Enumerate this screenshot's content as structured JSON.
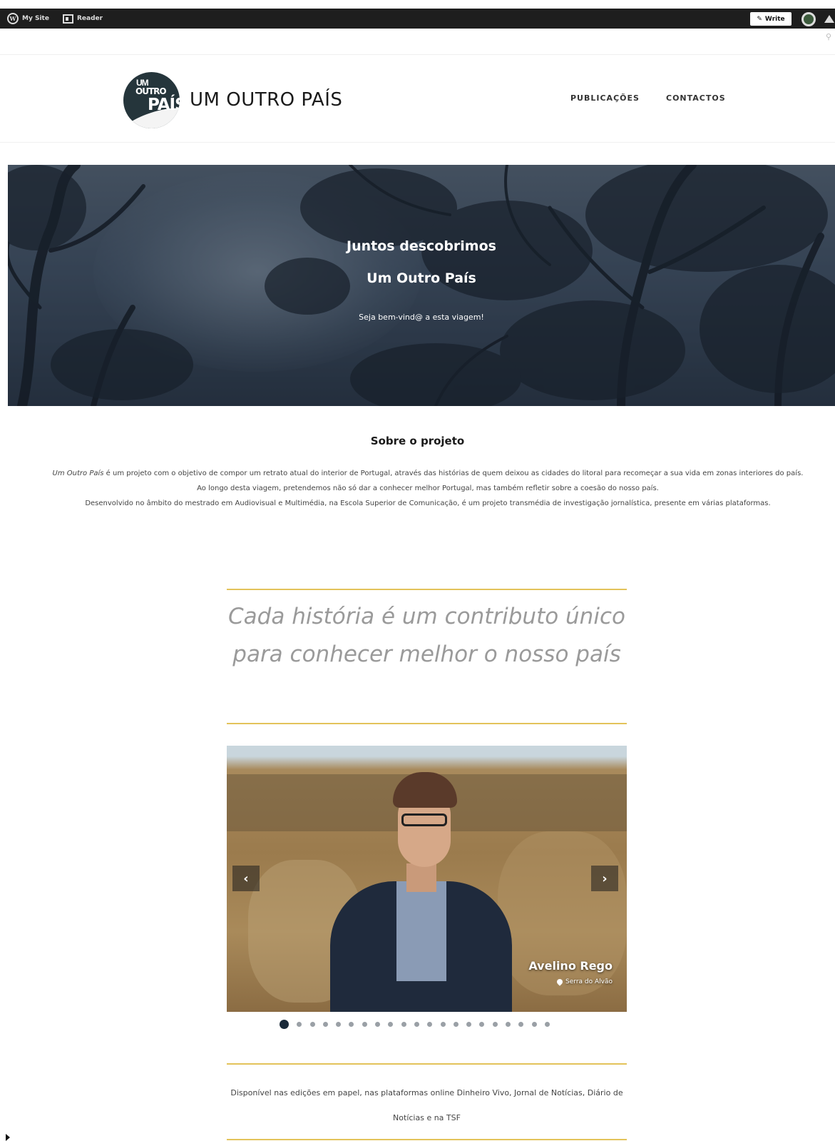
{
  "adminbar": {
    "my_site": "My Site",
    "reader": "Reader",
    "write": "Write"
  },
  "header": {
    "logo": {
      "line1": "UM",
      "line2": "OUTRO",
      "line3": "PAÍS"
    },
    "site_title": "UM OUTRO PAÍS",
    "nav": [
      "PUBLICAÇÕES",
      "CONTACTOS"
    ]
  },
  "hero": {
    "title_line1": "Juntos descobrimos",
    "title_line2": "Um Outro País",
    "subtitle": "Seja bem-vind@ a esta viagem!"
  },
  "about": {
    "title": "Sobre o projeto",
    "para1_em": "Um Outro País",
    "para1": " é um projeto com o objetivo de compor um retrato atual do interior de Portugal, através das histórias de quem deixou as cidades do litoral para recomeçar a sua vida em zonas interiores do país. Ao longo desta viagem, pretendemos não só dar a conhecer melhor Portugal, mas também refletir sobre a coesão do nosso país.",
    "para2": "Desenvolvido no âmbito do mestrado em Audiovisual e Multimédia, na Escola Superior de Comunicação, é um projeto transmédia de investigação jornalística, presente em várias plataformas."
  },
  "quote": "Cada história é um contributo único para conhecer melhor o nosso país",
  "carousel": {
    "caption_name": "Avelino Rego",
    "caption_location": "Serra do Alvão",
    "slide_count": 21,
    "active_index": 0
  },
  "availability": "Disponível nas edições em papel, nas plataformas online Dinheiro Vivo, Jornal de Notícias, Diário de Notícias e na TSF",
  "colors": {
    "accent_gold": "#e3c35a",
    "adminbar": "#1e1e1e",
    "logo_bg": "#25353b"
  },
  "icons": [
    "wordpress-icon",
    "reader-icon",
    "pencil-icon",
    "avatar",
    "bell-icon",
    "search-icon",
    "chevron-left-icon",
    "chevron-right-icon",
    "map-pin-icon"
  ]
}
